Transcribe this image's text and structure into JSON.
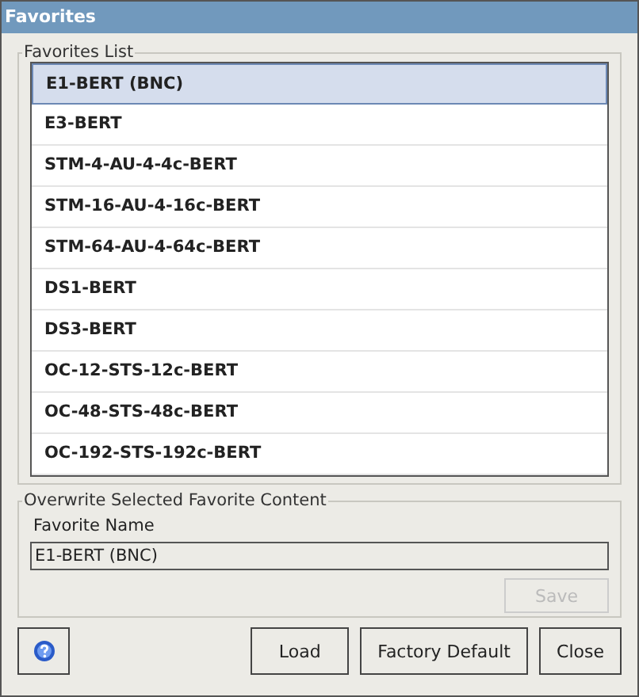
{
  "window": {
    "title": "Favorites"
  },
  "favorites_list": {
    "title": "Favorites List",
    "items": [
      {
        "label": "E1-BERT (BNC)",
        "selected": true
      },
      {
        "label": "E3-BERT",
        "selected": false
      },
      {
        "label": "STM-4-AU-4-4c-BERT",
        "selected": false
      },
      {
        "label": "STM-16-AU-4-16c-BERT",
        "selected": false
      },
      {
        "label": "STM-64-AU-4-64c-BERT",
        "selected": false
      },
      {
        "label": "DS1-BERT",
        "selected": false
      },
      {
        "label": "DS3-BERT",
        "selected": false
      },
      {
        "label": "OC-12-STS-12c-BERT",
        "selected": false
      },
      {
        "label": "OC-48-STS-48c-BERT",
        "selected": false
      },
      {
        "label": "OC-192-STS-192c-BERT",
        "selected": false
      }
    ]
  },
  "overwrite": {
    "title": "Overwrite Selected Favorite Content",
    "field_label": "Favorite Name",
    "field_value": "E1-BERT (BNC)",
    "save_button": {
      "label": "Save",
      "disabled": true
    }
  },
  "buttons": [
    "Load",
    "Factory Default",
    "Close"
  ]
}
